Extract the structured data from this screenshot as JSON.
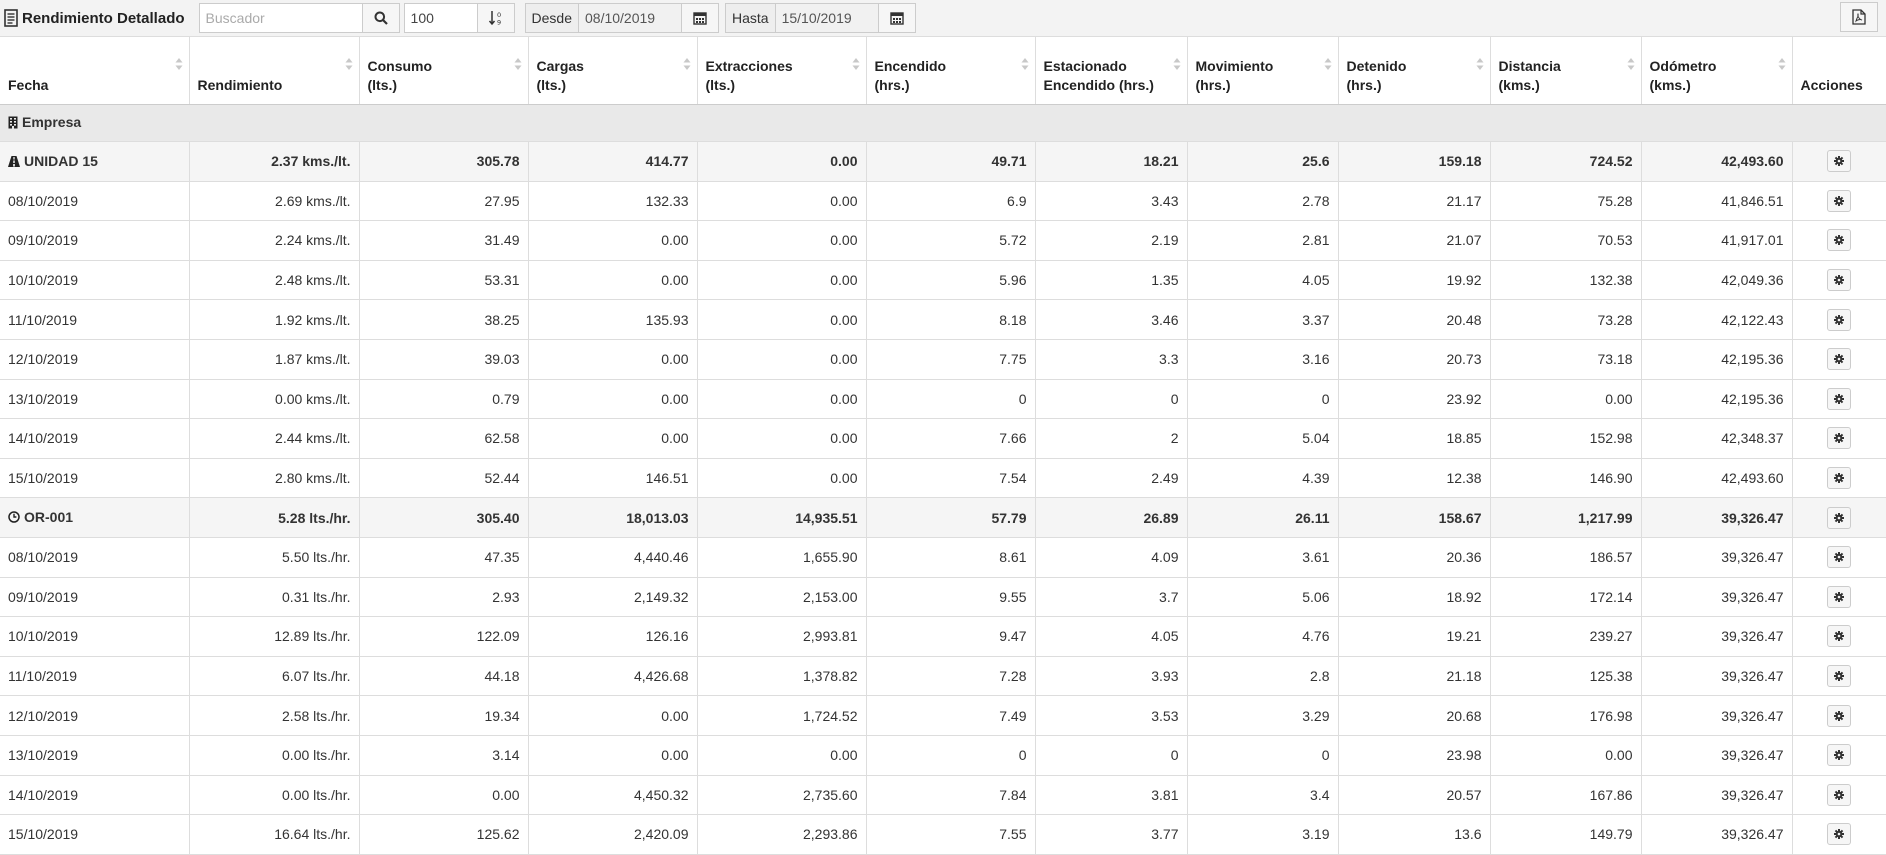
{
  "toolbar": {
    "title": "Rendimiento Detallado",
    "search_placeholder": "Buscador",
    "limit": "100",
    "desde_label": "Desde",
    "desde_value": "08/10/2019",
    "hasta_label": "Hasta",
    "hasta_value": "15/10/2019"
  },
  "columns": [
    {
      "l1": "",
      "l2": "Fecha"
    },
    {
      "l1": "",
      "l2": "Rendimiento"
    },
    {
      "l1": "Consumo",
      "l2": "(lts.)"
    },
    {
      "l1": "Cargas",
      "l2": "(lts.)"
    },
    {
      "l1": "Extracciones",
      "l2": "(lts.)"
    },
    {
      "l1": "Encendido",
      "l2": "(hrs.)"
    },
    {
      "l1": "Estacionado",
      "l2": "Encendido (hrs.)"
    },
    {
      "l1": "Movimiento",
      "l2": "(hrs.)"
    },
    {
      "l1": "Detenido",
      "l2": "(hrs.)"
    },
    {
      "l1": "Distancia",
      "l2": "(kms.)"
    },
    {
      "l1": "Odómetro",
      "l2": "(kms.)"
    },
    {
      "l1": "",
      "l2": "Acciones"
    }
  ],
  "group_label": "Empresa",
  "units": [
    {
      "name": "UNIDAD 15",
      "icon": "road-icon",
      "summary": [
        "2.37 kms./lt.",
        "305.78",
        "414.77",
        "0.00",
        "49.71",
        "18.21",
        "25.6",
        "159.18",
        "724.52",
        "42,493.60"
      ],
      "rows": [
        [
          "08/10/2019",
          "2.69 kms./lt.",
          "27.95",
          "132.33",
          "0.00",
          "6.9",
          "3.43",
          "2.78",
          "21.17",
          "75.28",
          "41,846.51"
        ],
        [
          "09/10/2019",
          "2.24 kms./lt.",
          "31.49",
          "0.00",
          "0.00",
          "5.72",
          "2.19",
          "2.81",
          "21.07",
          "70.53",
          "41,917.01"
        ],
        [
          "10/10/2019",
          "2.48 kms./lt.",
          "53.31",
          "0.00",
          "0.00",
          "5.96",
          "1.35",
          "4.05",
          "19.92",
          "132.38",
          "42,049.36"
        ],
        [
          "11/10/2019",
          "1.92 kms./lt.",
          "38.25",
          "135.93",
          "0.00",
          "8.18",
          "3.46",
          "3.37",
          "20.48",
          "73.28",
          "42,122.43"
        ],
        [
          "12/10/2019",
          "1.87 kms./lt.",
          "39.03",
          "0.00",
          "0.00",
          "7.75",
          "3.3",
          "3.16",
          "20.73",
          "73.18",
          "42,195.36"
        ],
        [
          "13/10/2019",
          "0.00 kms./lt.",
          "0.79",
          "0.00",
          "0.00",
          "0",
          "0",
          "0",
          "23.92",
          "0.00",
          "42,195.36"
        ],
        [
          "14/10/2019",
          "2.44 kms./lt.",
          "62.58",
          "0.00",
          "0.00",
          "7.66",
          "2",
          "5.04",
          "18.85",
          "152.98",
          "42,348.37"
        ],
        [
          "15/10/2019",
          "2.80 kms./lt.",
          "52.44",
          "146.51",
          "0.00",
          "7.54",
          "2.49",
          "4.39",
          "12.38",
          "146.90",
          "42,493.60"
        ]
      ]
    },
    {
      "name": "OR-001",
      "icon": "clock-icon",
      "summary": [
        "5.28 lts./hr.",
        "305.40",
        "18,013.03",
        "14,935.51",
        "57.79",
        "26.89",
        "26.11",
        "158.67",
        "1,217.99",
        "39,326.47"
      ],
      "rows": [
        [
          "08/10/2019",
          "5.50 lts./hr.",
          "47.35",
          "4,440.46",
          "1,655.90",
          "8.61",
          "4.09",
          "3.61",
          "20.36",
          "186.57",
          "39,326.47"
        ],
        [
          "09/10/2019",
          "0.31 lts./hr.",
          "2.93",
          "2,149.32",
          "2,153.00",
          "9.55",
          "3.7",
          "5.06",
          "18.92",
          "172.14",
          "39,326.47"
        ],
        [
          "10/10/2019",
          "12.89 lts./hr.",
          "122.09",
          "126.16",
          "2,993.81",
          "9.47",
          "4.05",
          "4.76",
          "19.21",
          "239.27",
          "39,326.47"
        ],
        [
          "11/10/2019",
          "6.07 lts./hr.",
          "44.18",
          "4,426.68",
          "1,378.82",
          "7.28",
          "3.93",
          "2.8",
          "21.18",
          "125.38",
          "39,326.47"
        ],
        [
          "12/10/2019",
          "2.58 lts./hr.",
          "19.34",
          "0.00",
          "1,724.52",
          "7.49",
          "3.53",
          "3.29",
          "20.68",
          "176.98",
          "39,326.47"
        ],
        [
          "13/10/2019",
          "0.00 lts./hr.",
          "3.14",
          "0.00",
          "0.00",
          "0",
          "0",
          "0",
          "23.98",
          "0.00",
          "39,326.47"
        ],
        [
          "14/10/2019",
          "0.00 lts./hr.",
          "0.00",
          "4,450.32",
          "2,735.60",
          "7.84",
          "3.81",
          "3.4",
          "20.57",
          "167.86",
          "39,326.47"
        ],
        [
          "15/10/2019",
          "16.64 lts./hr.",
          "125.62",
          "2,420.09",
          "2,293.86",
          "7.55",
          "3.77",
          "3.19",
          "13.6",
          "149.79",
          "39,326.47"
        ]
      ]
    }
  ]
}
